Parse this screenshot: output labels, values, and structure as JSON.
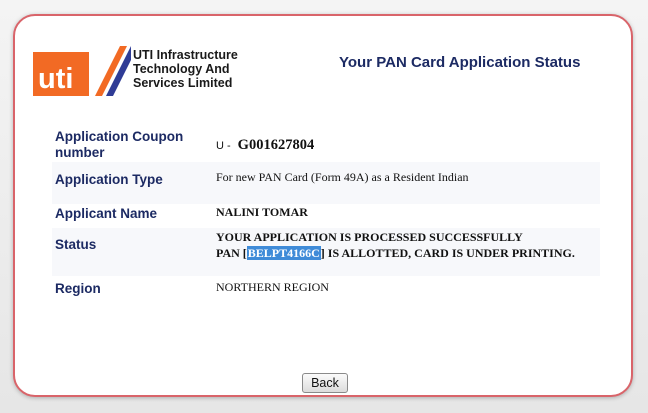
{
  "company": {
    "logo_text": "uti",
    "name_lines": [
      "UTI Infrastructure",
      "Technology And",
      "Services Limited"
    ]
  },
  "page_title": "Your PAN Card Application Status",
  "fields": {
    "coupon": {
      "label_lines": [
        "Application Coupon",
        "number"
      ],
      "prefix": "U -",
      "value": "G001627804"
    },
    "app_type": {
      "label": "Application Type",
      "value": "For new PAN Card (Form 49A) as a Resident Indian"
    },
    "applicant": {
      "label": "Applicant Name",
      "value": "NALINI TOMAR"
    },
    "status": {
      "label": "Status",
      "line1": "YOUR APPLICATION IS PROCESSED SUCCESSFULLY",
      "pan_prefix": "PAN [",
      "pan": "BELPT4166C",
      "pan_suffix": "] IS ALLOTTED, CARD IS UNDER PRINTING."
    },
    "region": {
      "label": "Region",
      "value": "NORTHERN REGION"
    }
  },
  "actions": {
    "back_label": "Back"
  },
  "colors": {
    "border": "#d9646a",
    "label_navy": "#1c2a63",
    "logo_orange": "#f26a24",
    "logo_blue": "#2f3c96",
    "highlight": "#3f8bd8"
  }
}
